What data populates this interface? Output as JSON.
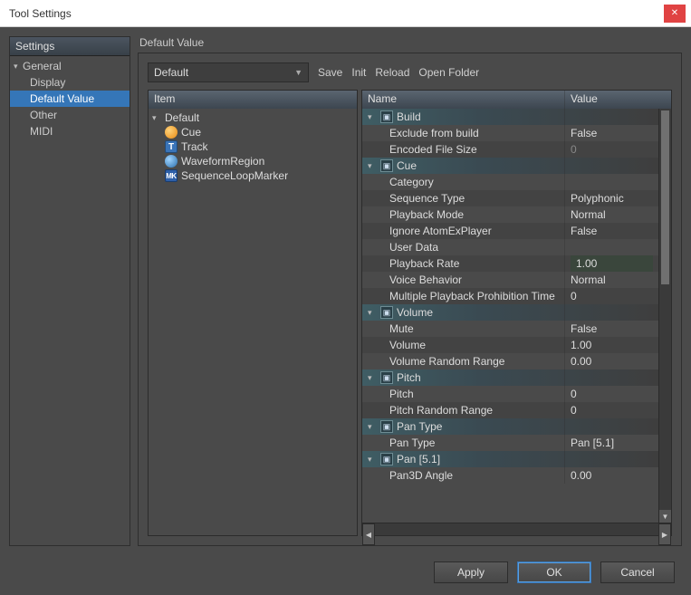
{
  "window": {
    "title": "Tool Settings"
  },
  "sidebar": {
    "header": "Settings",
    "root": "General",
    "items": [
      "Display",
      "Default Value",
      "Other",
      "MIDI"
    ],
    "selected_index": 1
  },
  "content": {
    "title": "Default Value",
    "dropdown": {
      "value": "Default"
    },
    "actions": {
      "save": "Save",
      "init": "Init",
      "reload": "Reload",
      "open_folder": "Open Folder"
    }
  },
  "item_panel": {
    "header": "Item",
    "root": "Default",
    "children": [
      {
        "icon": "cue-icon",
        "label": "Cue"
      },
      {
        "icon": "track-icon",
        "label": "Track"
      },
      {
        "icon": "waveform-region-icon",
        "label": "WaveformRegion"
      },
      {
        "icon": "sequence-loop-marker-icon",
        "label": "SequenceLoopMarker"
      }
    ]
  },
  "prop_panel": {
    "header_name": "Name",
    "header_value": "Value",
    "rows": [
      {
        "type": "group",
        "label": "Build"
      },
      {
        "type": "prop",
        "name": "Exclude from build",
        "value": "False"
      },
      {
        "type": "prop",
        "name": "Encoded File Size",
        "value": "0",
        "disabled": true
      },
      {
        "type": "group",
        "label": "Cue"
      },
      {
        "type": "prop",
        "name": "Category",
        "value": ""
      },
      {
        "type": "prop",
        "name": "Sequence Type",
        "value": "Polyphonic"
      },
      {
        "type": "prop",
        "name": "Playback Mode",
        "value": "Normal"
      },
      {
        "type": "prop",
        "name": "Ignore AtomExPlayer",
        "value": "False"
      },
      {
        "type": "prop",
        "name": "User Data",
        "value": ""
      },
      {
        "type": "prop",
        "name": "Playback Rate",
        "value": "1.00",
        "input": true
      },
      {
        "type": "prop",
        "name": "Voice Behavior",
        "value": "Normal"
      },
      {
        "type": "prop",
        "name": "Multiple Playback Prohibition Time",
        "value": "0"
      },
      {
        "type": "group",
        "label": "Volume"
      },
      {
        "type": "prop",
        "name": "Mute",
        "value": "False"
      },
      {
        "type": "prop",
        "name": "Volume",
        "value": "1.00"
      },
      {
        "type": "prop",
        "name": "Volume Random Range",
        "value": "0.00"
      },
      {
        "type": "group",
        "label": "Pitch"
      },
      {
        "type": "prop",
        "name": "Pitch",
        "value": "0"
      },
      {
        "type": "prop",
        "name": "Pitch Random Range",
        "value": "0"
      },
      {
        "type": "group",
        "label": "Pan Type"
      },
      {
        "type": "prop",
        "name": "Pan Type",
        "value": "Pan [5.1]"
      },
      {
        "type": "group",
        "label": "Pan [5.1]"
      },
      {
        "type": "prop",
        "name": "Pan3D Angle",
        "value": "0.00"
      }
    ]
  },
  "footer": {
    "apply": "Apply",
    "ok": "OK",
    "cancel": "Cancel"
  }
}
